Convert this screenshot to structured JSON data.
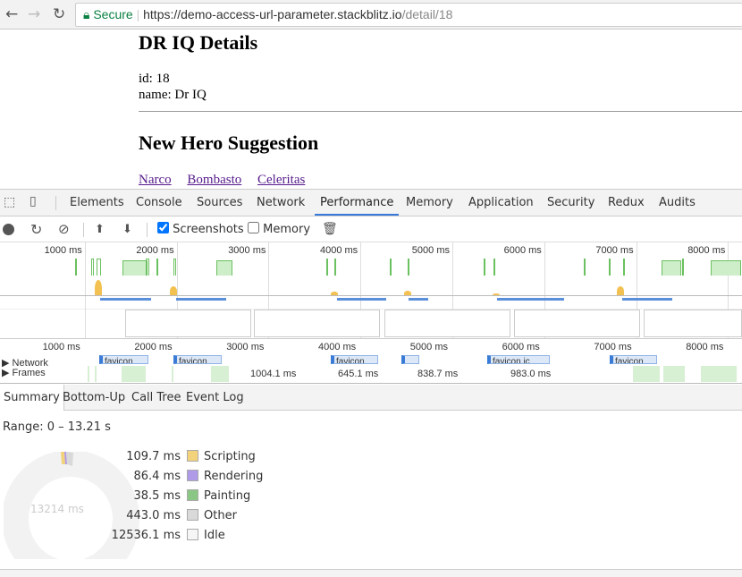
{
  "browser": {
    "secure_label": "Secure",
    "url_host": "https://demo-access-url-parameter.stackblitz.io",
    "url_path": "/detail/18"
  },
  "page": {
    "title": "DR IQ Details",
    "id_line": "id: 18",
    "name_line": "name: Dr IQ",
    "suggestion_title": "New Hero Suggestion",
    "suggestions": [
      "Narco",
      "Bombasto",
      "Celeritas"
    ]
  },
  "devtools": {
    "tabs": [
      "Elements",
      "Console",
      "Sources",
      "Network",
      "Performance",
      "Memory",
      "Application",
      "Security",
      "Redux",
      "Audits"
    ],
    "active_tab": "Performance",
    "toolbar": {
      "screenshots_label": "Screenshots",
      "screenshots_checked": true,
      "memory_label": "Memory",
      "memory_checked": false
    },
    "timeline": {
      "ticks": [
        "1000 ms",
        "2000 ms",
        "3000 ms",
        "4000 ms",
        "5000 ms",
        "6000 ms",
        "7000 ms",
        "8000 ms"
      ],
      "network_label": "Network",
      "frames_label": "Frames",
      "network_items": [
        "favicon",
        "favicon",
        "favicon",
        "",
        "favicon.ic",
        "favicon"
      ],
      "frame_durations": [
        "1004.1 ms",
        "645.1 ms",
        "838.7 ms",
        "983.0 ms"
      ]
    },
    "summary": {
      "tabs": [
        "Summary",
        "Bottom-Up",
        "Call Tree",
        "Event Log"
      ],
      "active": "Summary",
      "range": "Range: 0 – 13.21 s",
      "total": "13214 ms",
      "items": [
        {
          "value": "109.7 ms",
          "label": "Scripting",
          "color": "#f2d27a"
        },
        {
          "value": "86.4 ms",
          "label": "Rendering",
          "color": "#af9ae8"
        },
        {
          "value": "38.5 ms",
          "label": "Painting",
          "color": "#8ac784"
        },
        {
          "value": "443.0 ms",
          "label": "Other",
          "color": "#d9d9d9"
        },
        {
          "value": "12536.1 ms",
          "label": "Idle",
          "color": "#f5f5f5"
        }
      ]
    }
  }
}
